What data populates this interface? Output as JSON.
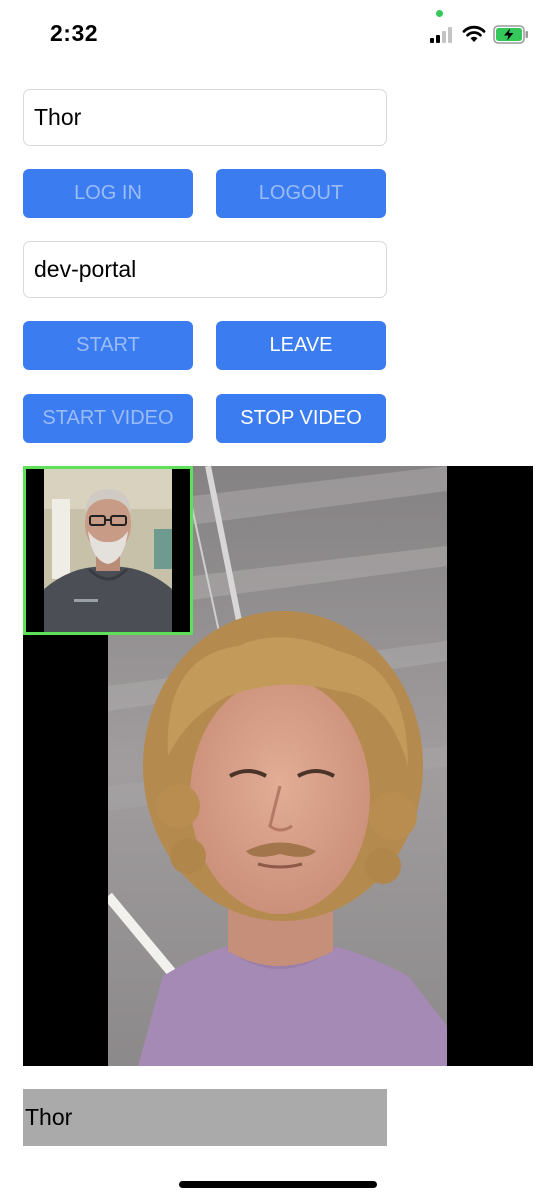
{
  "status_bar": {
    "time": "2:32"
  },
  "login": {
    "username_value": "Thor",
    "login_label": "LOG IN",
    "logout_label": "LOGOUT"
  },
  "session": {
    "session_value": "dev-portal",
    "start_label": "START",
    "leave_label": "LEAVE"
  },
  "video_controls": {
    "start_video_label": "START VIDEO",
    "stop_video_label": "STOP VIDEO"
  },
  "participant": {
    "name": "Thor"
  },
  "colors": {
    "button_bg": "#3b7cf0",
    "button_text_enabled": "#ffffff",
    "button_text_disabled": "#9bbcf6",
    "local_video_border": "#5ee05a",
    "name_label_bg": "#aaaaaa"
  }
}
